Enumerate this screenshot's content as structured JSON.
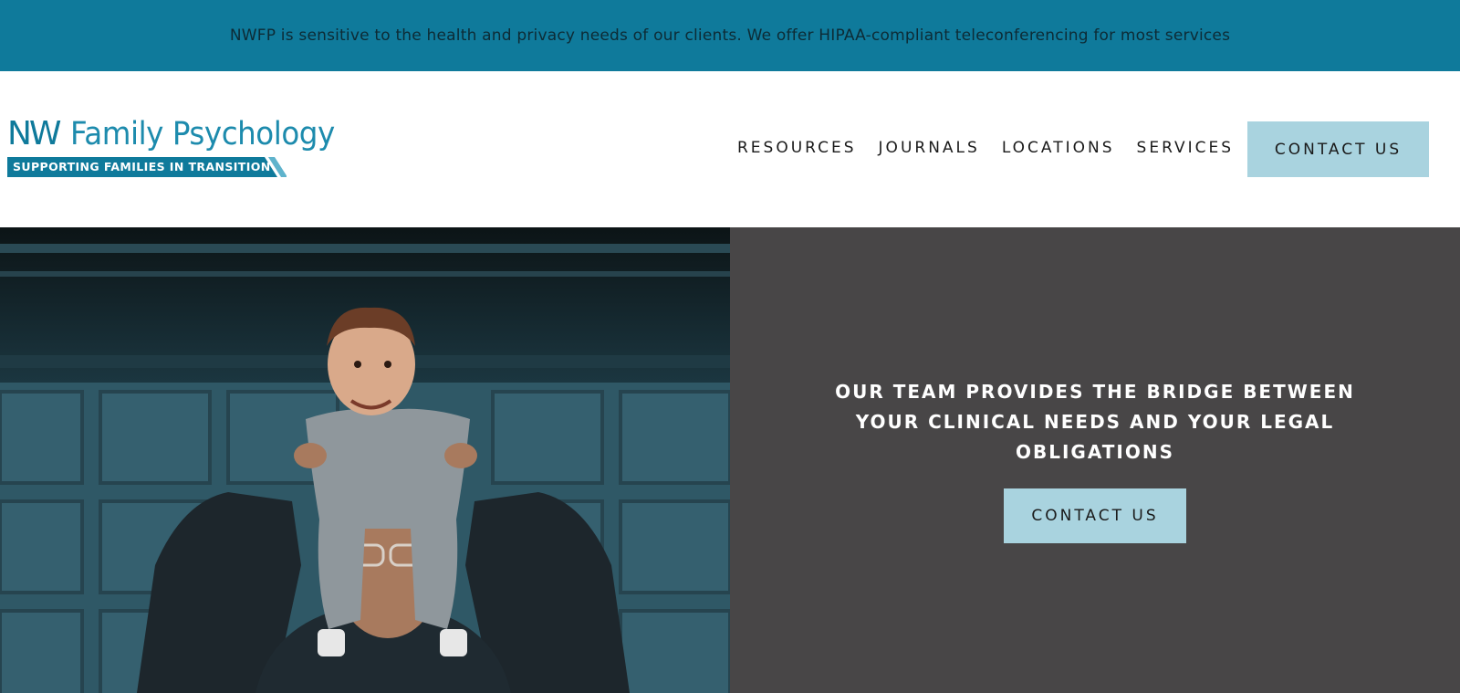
{
  "banner": {
    "text": "NWFP is sensitive to the health and privacy needs of our clients. We offer HIPAA-compliant teleconferencing for most services"
  },
  "logo": {
    "nw": "NW",
    "name": "Family Psychology",
    "tagline": "SUPPORTING FAMILIES IN TRANSITION"
  },
  "nav": {
    "items": [
      {
        "label": "RESOURCES"
      },
      {
        "label": "JOURNALS"
      },
      {
        "label": "LOCATIONS"
      },
      {
        "label": "SERVICES"
      }
    ],
    "contact_label": "CONTACT US"
  },
  "hero": {
    "heading_lines": [
      "OUR TEAM PROVIDES THE BRIDGE BETWEEN",
      "YOUR CLINICAL NEEDS AND YOUR LEGAL",
      "OBLIGATIONS"
    ],
    "cta_label": "CONTACT US"
  },
  "colors": {
    "banner": "#0f7a9b",
    "brand": "#1d8bad",
    "button": "#a9d3df",
    "panel": "#484647"
  }
}
